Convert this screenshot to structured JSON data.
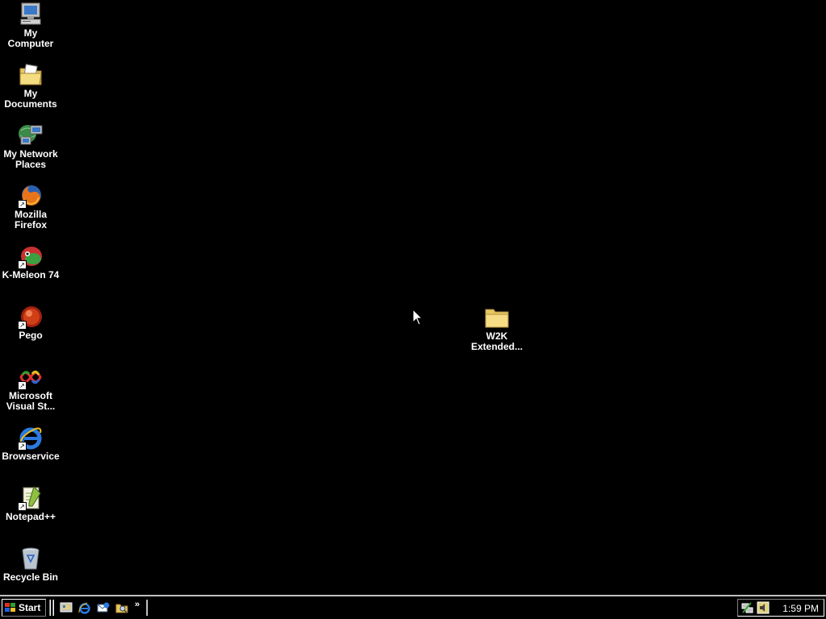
{
  "desktop": {
    "icons": [
      {
        "label": "My\nComputer",
        "icon": "my-computer-icon"
      },
      {
        "label": "My\nDocuments",
        "icon": "my-documents-icon"
      },
      {
        "label": "My Network\nPlaces",
        "icon": "network-places-icon"
      },
      {
        "label": "Mozilla\nFirefox",
        "icon": "firefox-icon"
      },
      {
        "label": "K-Meleon 74",
        "icon": "k-meleon-icon"
      },
      {
        "label": "Pego",
        "icon": "pego-icon"
      },
      {
        "label": "Microsoft\nVisual St...",
        "icon": "visual-studio-icon"
      },
      {
        "label": "Browservice",
        "icon": "internet-explorer-icon"
      },
      {
        "label": "Notepad++",
        "icon": "notepad-plus-plus-icon"
      },
      {
        "label": "Recycle Bin",
        "icon": "recycle-bin-icon"
      },
      {
        "label": "W2K\nExtended...",
        "icon": "folder-icon"
      }
    ]
  },
  "taskbar": {
    "start_label": "Start",
    "quick_launch": [
      "show-desktop-icon",
      "internet-explorer-icon",
      "outlook-express-icon",
      "windows-explorer-icon"
    ],
    "more_label": "»",
    "tray_icons": [
      "network-tray-icon",
      "volume-tray-icon"
    ],
    "clock": "1:59 PM"
  },
  "colors": {
    "desktop_background": "#000000",
    "taskbar_border": "#c0c0c0",
    "icon_label_text": "#ffffff"
  }
}
